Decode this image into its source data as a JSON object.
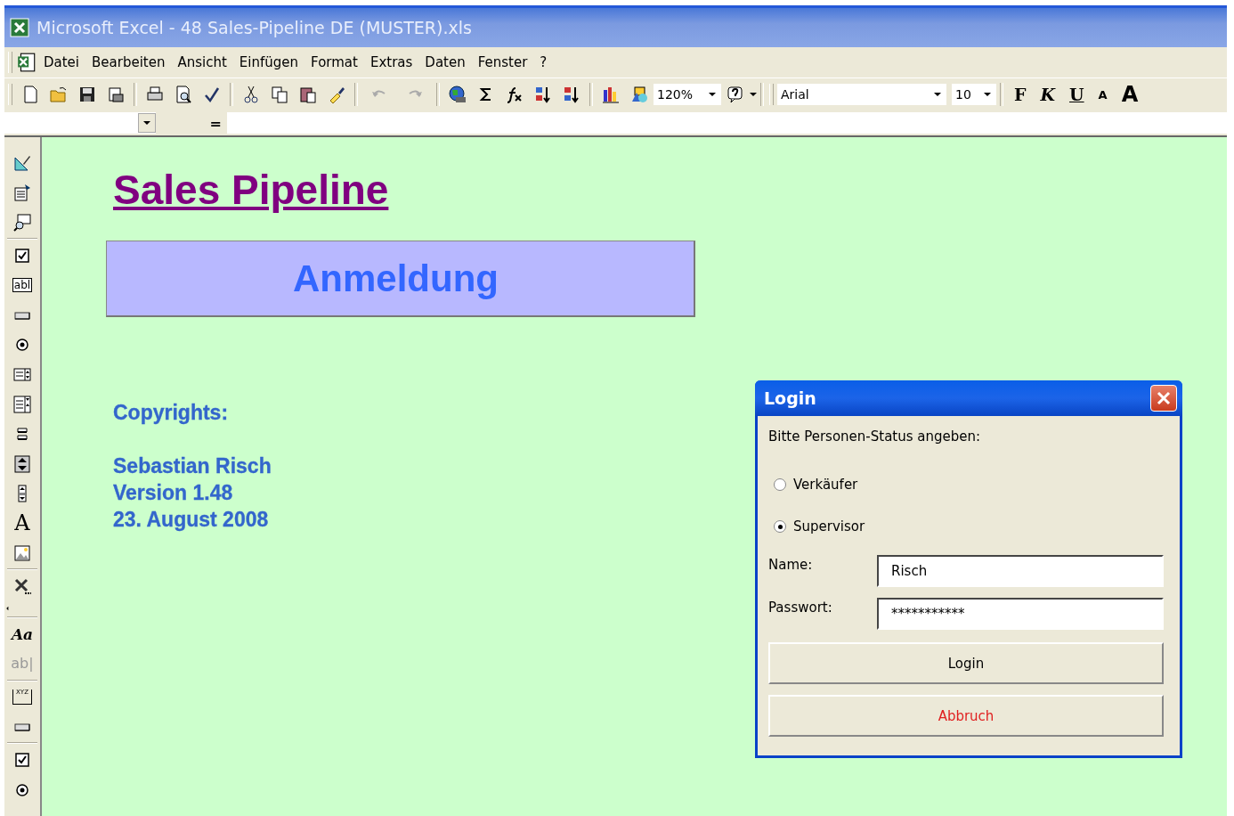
{
  "window": {
    "title": "Microsoft Excel - 48 Sales-Pipeline DE (MUSTER).xls"
  },
  "menu": [
    "Datei",
    "Bearbeiten",
    "Ansicht",
    "Einfügen",
    "Format",
    "Extras",
    "Daten",
    "Fenster",
    "?"
  ],
  "toolbar": {
    "zoom": "120%",
    "font": "Arial",
    "size": "10",
    "format_buttons": [
      "F",
      "K",
      "U"
    ],
    "size_buttons": [
      "A",
      "A"
    ]
  },
  "formula_bar": {
    "equals": "="
  },
  "control_toolbox": [
    {
      "kind": "design"
    },
    {
      "kind": "properties"
    },
    {
      "kind": "code"
    },
    {
      "kind": "separator"
    },
    {
      "kind": "checkbox"
    },
    {
      "kind": "textbox",
      "glyph": "abl"
    },
    {
      "kind": "button"
    },
    {
      "kind": "radio"
    },
    {
      "kind": "listbox"
    },
    {
      "kind": "combobox"
    },
    {
      "kind": "toggle"
    },
    {
      "kind": "spin"
    },
    {
      "kind": "scroll"
    },
    {
      "kind": "label",
      "glyph": "A"
    },
    {
      "kind": "image"
    },
    {
      "kind": "separator"
    },
    {
      "kind": "tools"
    },
    {
      "kind": "arrow"
    },
    {
      "kind": "separator"
    },
    {
      "kind": "fontlabel",
      "glyph": "Aa"
    },
    {
      "kind": "editbox",
      "glyph": "ab|"
    },
    {
      "kind": "separator"
    },
    {
      "kind": "groupbox",
      "glyph": "XYZ"
    },
    {
      "kind": "button"
    },
    {
      "kind": "separator"
    },
    {
      "kind": "checkbox"
    },
    {
      "kind": "radio"
    }
  ],
  "sheet": {
    "heading": "Sales Pipeline",
    "banner": "Anmeldung",
    "copyright_label": "Copyrights:",
    "lines": [
      "Sebastian Risch",
      "Version 1.48",
      "23. August 2008"
    ]
  },
  "dialog": {
    "title": "Login",
    "prompt": "Bitte Personen-Status angeben:",
    "options": [
      {
        "label": "Verkäufer",
        "selected": false
      },
      {
        "label": "Supervisor",
        "selected": true
      }
    ],
    "fields": [
      {
        "label": "Name:",
        "value": "Risch"
      },
      {
        "label": "Passwort:",
        "value": "***********"
      }
    ],
    "buttons": [
      {
        "label": "Login",
        "kind": "default"
      },
      {
        "label": "Abbruch",
        "kind": "cancel"
      }
    ]
  }
}
